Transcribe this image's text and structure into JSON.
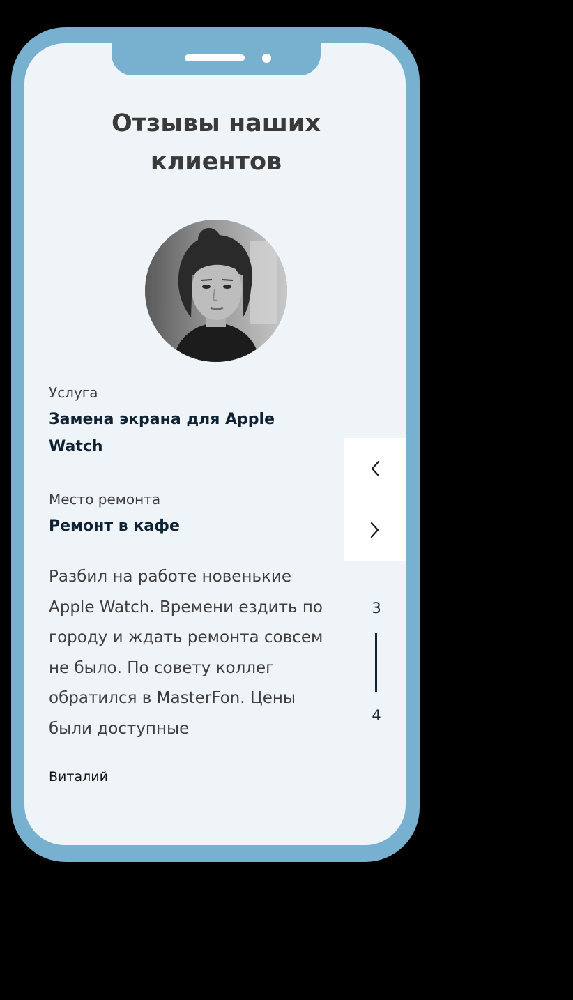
{
  "section": {
    "title": "Отзывы наших клиентов"
  },
  "review": {
    "service_label": "Услуга",
    "service_value": "Замена экрана для Apple Watch",
    "place_label": "Место ремонта",
    "place_value": "Ремонт в кафе",
    "text": "Разбил на работе новенькие Apple Watch. Времени ездить по городу и ждать ремонта совсем не было. По совету коллег обратился в MasterFon. Цены были доступные",
    "author": "Виталий"
  },
  "pagination": {
    "current": "3",
    "next": "4"
  },
  "colors": {
    "frame": "#78b1cf",
    "screen": "#eff4f8",
    "heading": "#3a3a3a",
    "accent_text": "#0e2233"
  },
  "icons": {
    "prev": "chevron-left-icon",
    "next": "chevron-right-icon"
  }
}
